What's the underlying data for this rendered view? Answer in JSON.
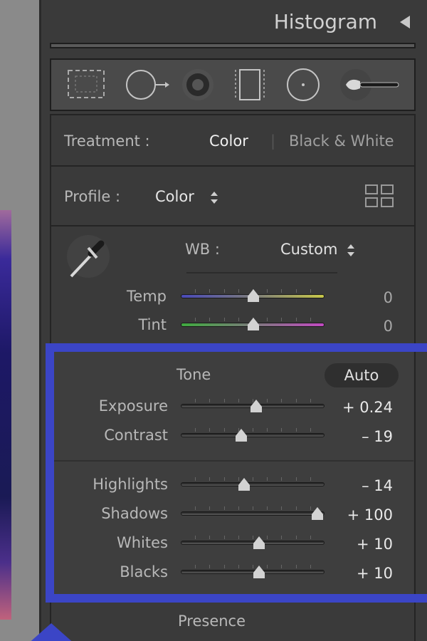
{
  "header": {
    "title": "Histogram"
  },
  "tools": [
    "crop-overlay-icon",
    "spot-removal-icon",
    "red-eye-icon",
    "graduated-filter-icon",
    "radial-filter-icon",
    "adjustment-brush-icon"
  ],
  "treatment": {
    "label": "Treatment :",
    "color": "Color",
    "bw": "Black & White"
  },
  "profile": {
    "label": "Profile :",
    "value": "Color"
  },
  "wb": {
    "label": "WB :",
    "value": "Custom"
  },
  "basic_sliders": [
    {
      "label": "Temp",
      "value": "0",
      "pos": 0.5
    },
    {
      "label": "Tint",
      "value": "0",
      "pos": 0.5
    }
  ],
  "tone": {
    "label": "Tone",
    "auto": "Auto"
  },
  "tone_sliders": [
    {
      "label": "Exposure",
      "value": "+ 0.24",
      "pos": 0.52
    },
    {
      "label": "Contrast",
      "value": "– 19",
      "pos": 0.41
    }
  ],
  "tone_sliders2": [
    {
      "label": "Highlights",
      "value": "– 14",
      "pos": 0.44
    },
    {
      "label": "Shadows",
      "value": "+ 100",
      "pos": 0.95
    },
    {
      "label": "Whites",
      "value": "+ 10",
      "pos": 0.55
    },
    {
      "label": "Blacks",
      "value": "+ 10",
      "pos": 0.55
    }
  ],
  "presence": {
    "label": "Presence"
  },
  "colors": {
    "highlight": "#3b45c6",
    "panel": "#3a3a3a"
  }
}
